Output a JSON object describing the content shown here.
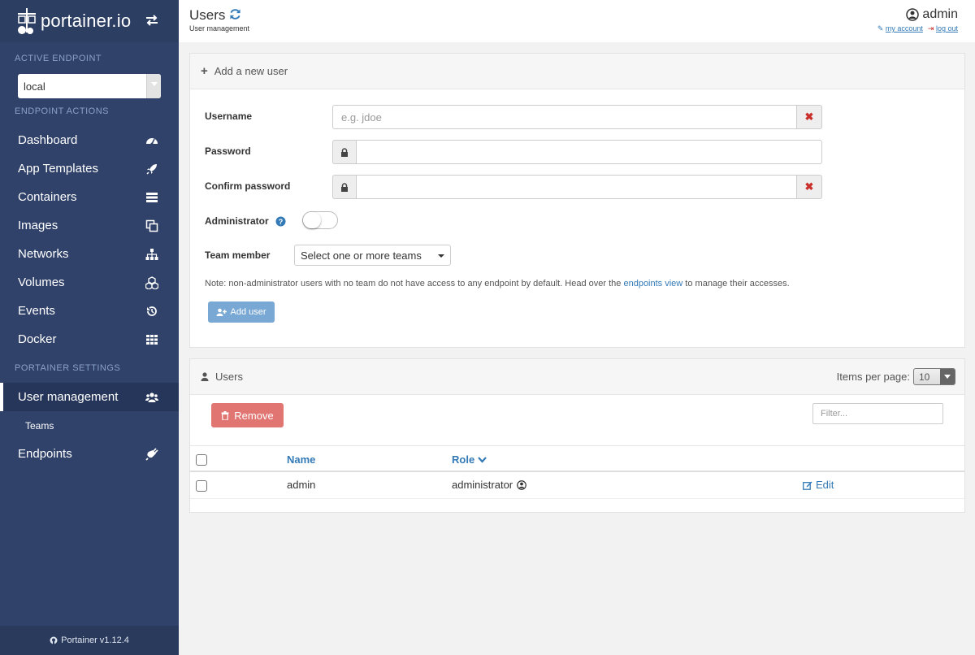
{
  "app": {
    "brand": "portainer.io",
    "version": "Portainer v1.12.4"
  },
  "sidebar": {
    "active_endpoint_title": "ACTIVE ENDPOINT",
    "endpoint_value": "local",
    "endpoint_actions_title": "ENDPOINT ACTIONS",
    "items": [
      {
        "label": "Dashboard",
        "icon": "tachometer-icon"
      },
      {
        "label": "App Templates",
        "icon": "rocket-icon"
      },
      {
        "label": "Containers",
        "icon": "server-icon"
      },
      {
        "label": "Images",
        "icon": "clone-icon"
      },
      {
        "label": "Networks",
        "icon": "sitemap-icon"
      },
      {
        "label": "Volumes",
        "icon": "cubes-icon"
      },
      {
        "label": "Events",
        "icon": "history-icon"
      },
      {
        "label": "Docker",
        "icon": "th-icon"
      }
    ],
    "settings_title": "PORTAINER SETTINGS",
    "settings_items": [
      {
        "label": "User management",
        "icon": "users-icon",
        "active": true
      },
      {
        "label": "Teams",
        "sub": true
      },
      {
        "label": "Endpoints",
        "icon": "plug-icon"
      }
    ]
  },
  "header": {
    "title": "Users",
    "breadcrumb": "User management",
    "username": "admin",
    "my_account": "my account",
    "log_out": "log out"
  },
  "add_user_panel": {
    "title": "Add a new user",
    "username_label": "Username",
    "username_placeholder": "e.g. jdoe",
    "password_label": "Password",
    "confirm_label": "Confirm password",
    "admin_label": "Administrator",
    "admin_enabled": false,
    "team_label": "Team member",
    "team_placeholder": "Select one or more teams",
    "note_prefix": "Note: non-administrator users with no team do not have access to any endpoint by default. Head over the ",
    "note_link": "endpoints view",
    "note_suffix": " to manage their accesses.",
    "submit_label": "Add user"
  },
  "users_panel": {
    "title": "Users",
    "items_per_page_label": "Items per page:",
    "items_per_page_value": "10",
    "remove_label": "Remove",
    "filter_placeholder": "Filter...",
    "columns": [
      "Name",
      "Role"
    ],
    "rows": [
      {
        "name": "admin",
        "role": "administrator",
        "action": "Edit"
      }
    ]
  },
  "colors": {
    "sidebar_bg": "#30426a",
    "link": "#337ab7",
    "danger": "#e07572",
    "primary_disabled": "#7aa8d4"
  }
}
